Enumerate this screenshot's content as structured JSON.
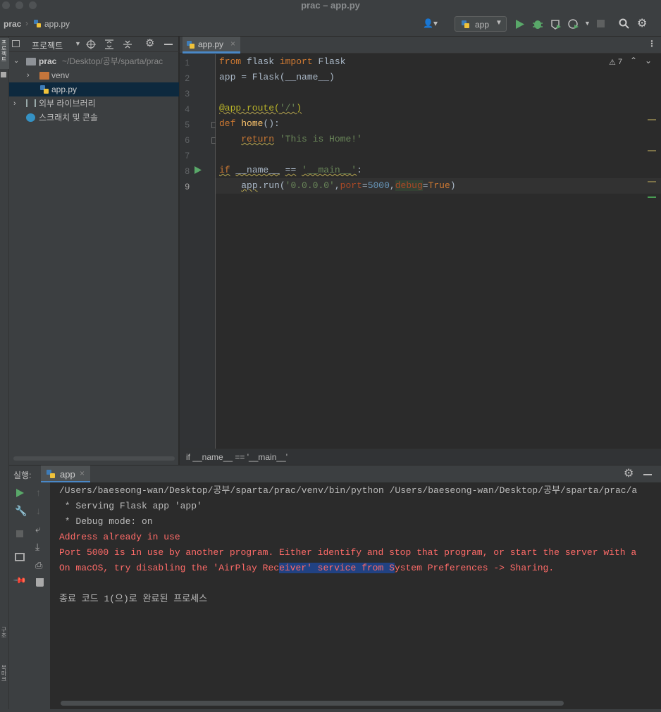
{
  "window": {
    "title": "prac – app.py"
  },
  "navbar": {
    "crumb_project": "prac",
    "crumb_file": "app.py",
    "run_config": "app"
  },
  "left_strip": {
    "project_label": "프로젝트",
    "structure_label": "구조",
    "bookmarks_label": "북마크"
  },
  "project_panel": {
    "title": "프로젝트",
    "root": {
      "name": "prac",
      "path": "~/Desktop/공부/sparta/prac"
    },
    "items": [
      {
        "name": "venv"
      },
      {
        "name": "app.py"
      },
      {
        "name": "외부 라이브러리"
      },
      {
        "name": "스크래치 및 콘솔"
      }
    ]
  },
  "editor": {
    "tab": "app.py",
    "warnings": "7",
    "line_numbers": [
      "1",
      "2",
      "3",
      "4",
      "5",
      "6",
      "7",
      "8",
      "9"
    ],
    "breadcrumb": "if __name__ == '__main__'"
  },
  "run_panel": {
    "label": "실행:",
    "tab": "app",
    "lines": [
      "/Users/baeseong-wan/Desktop/공부/sparta/prac/venv/bin/python /Users/baeseong-wan/Desktop/공부/sparta/prac/a",
      " * Serving Flask app 'app'",
      " * Debug mode: on",
      "Address already in use",
      "Port 5000 is in use by another program. Either identify and stop that program, or start the server with a",
      "On macOS, try disabling the 'AirPlay Rec",
      "eiver' service from S",
      "ystem Preferences -> Sharing.",
      "종료 코드 1(으)로 완료된 프로세스"
    ]
  },
  "colors": {
    "background": "#2b2b2b",
    "panel": "#3c3f41",
    "error": "#ff6b68",
    "selection": "#214283",
    "keyword": "#cc7832",
    "string": "#6a8759"
  }
}
